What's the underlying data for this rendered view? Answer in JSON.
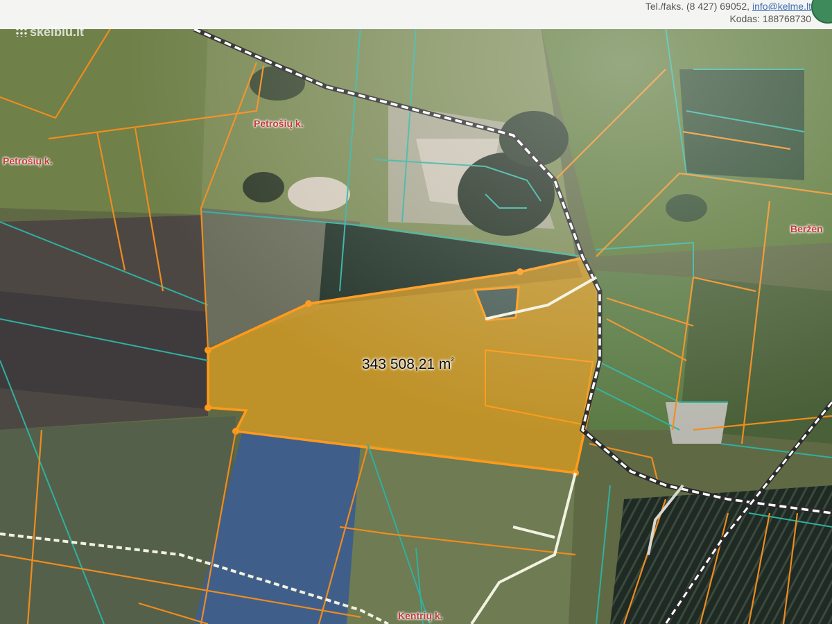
{
  "header": {
    "contact_line": "Tel./faks. (8 427) 69052,",
    "email": "info@kelme.lt",
    "code_line": "Kodas: 188768730"
  },
  "watermark": {
    "text": "skelbiu.lt"
  },
  "map": {
    "labels": {
      "petrosiu_top": "Petrošių k.",
      "petrosiu_left": "Petrošių k.",
      "berzenai": "Beržėn",
      "kentriu": "Kentrių k."
    },
    "area": {
      "value": "343 508,21 m",
      "unit_sup": "²"
    },
    "colors": {
      "parcel_fill": "#e5a21e",
      "parcel_stroke": "#ff9a1a",
      "boundary_orange": "#f08c1e",
      "boundary_teal": "#2fb0a0",
      "road_dashed": "#ffffff",
      "road_track": "#f2f2e0"
    }
  }
}
